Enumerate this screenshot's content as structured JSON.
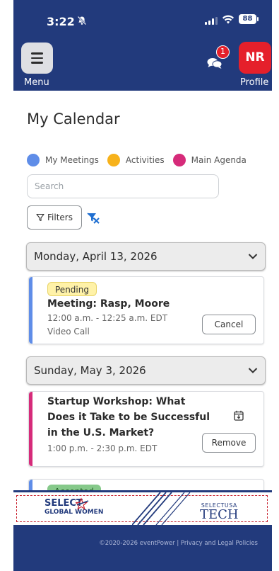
{
  "status_bar": {
    "time": "3:22",
    "battery": "88"
  },
  "nav": {
    "menu_label": "Menu",
    "profile_label": "Profile",
    "avatar_initials": "NR",
    "chat_badge": "1"
  },
  "page": {
    "title": "My Calendar"
  },
  "legend": [
    {
      "label": "My Meetings",
      "color": "#5f8de8"
    },
    {
      "label": "Activities",
      "color": "#f7b21b"
    },
    {
      "label": "Main Agenda",
      "color": "#d62b7a"
    }
  ],
  "search": {
    "placeholder": "Search"
  },
  "filters": {
    "label": "Filters"
  },
  "days": [
    {
      "date": "Monday, April 13, 2026",
      "events": [
        {
          "status": "Pending",
          "title": "Meeting: Rasp, Moore",
          "time": "12:00 a.m. - 12:25 a.m. EDT",
          "location": "Video Call",
          "action": "Cancel",
          "color": "#5f8de8"
        }
      ]
    },
    {
      "date": "Sunday, May 3, 2026",
      "events": [
        {
          "title_lines": [
            "Startup Workshop: What",
            "Does it Take to be Successful",
            "in the U.S. Market?"
          ],
          "time": "1:00 p.m. - 2:30 p.m. EDT",
          "action": "Remove",
          "color": "#d62b7a"
        },
        {
          "status": "Accepted",
          "color": "#5f8de8"
        }
      ]
    }
  ],
  "banner": {
    "left_logo_line1": "SELECT",
    "left_logo_line2": "GLOBAL WOMEN",
    "left_logo_vertical": "IN TECH",
    "right_logo_small": "SELECTUSA",
    "right_logo_large": "TECH"
  },
  "footer": {
    "text": "©2020-2026 eventPower | Privacy and Legal Policies"
  }
}
